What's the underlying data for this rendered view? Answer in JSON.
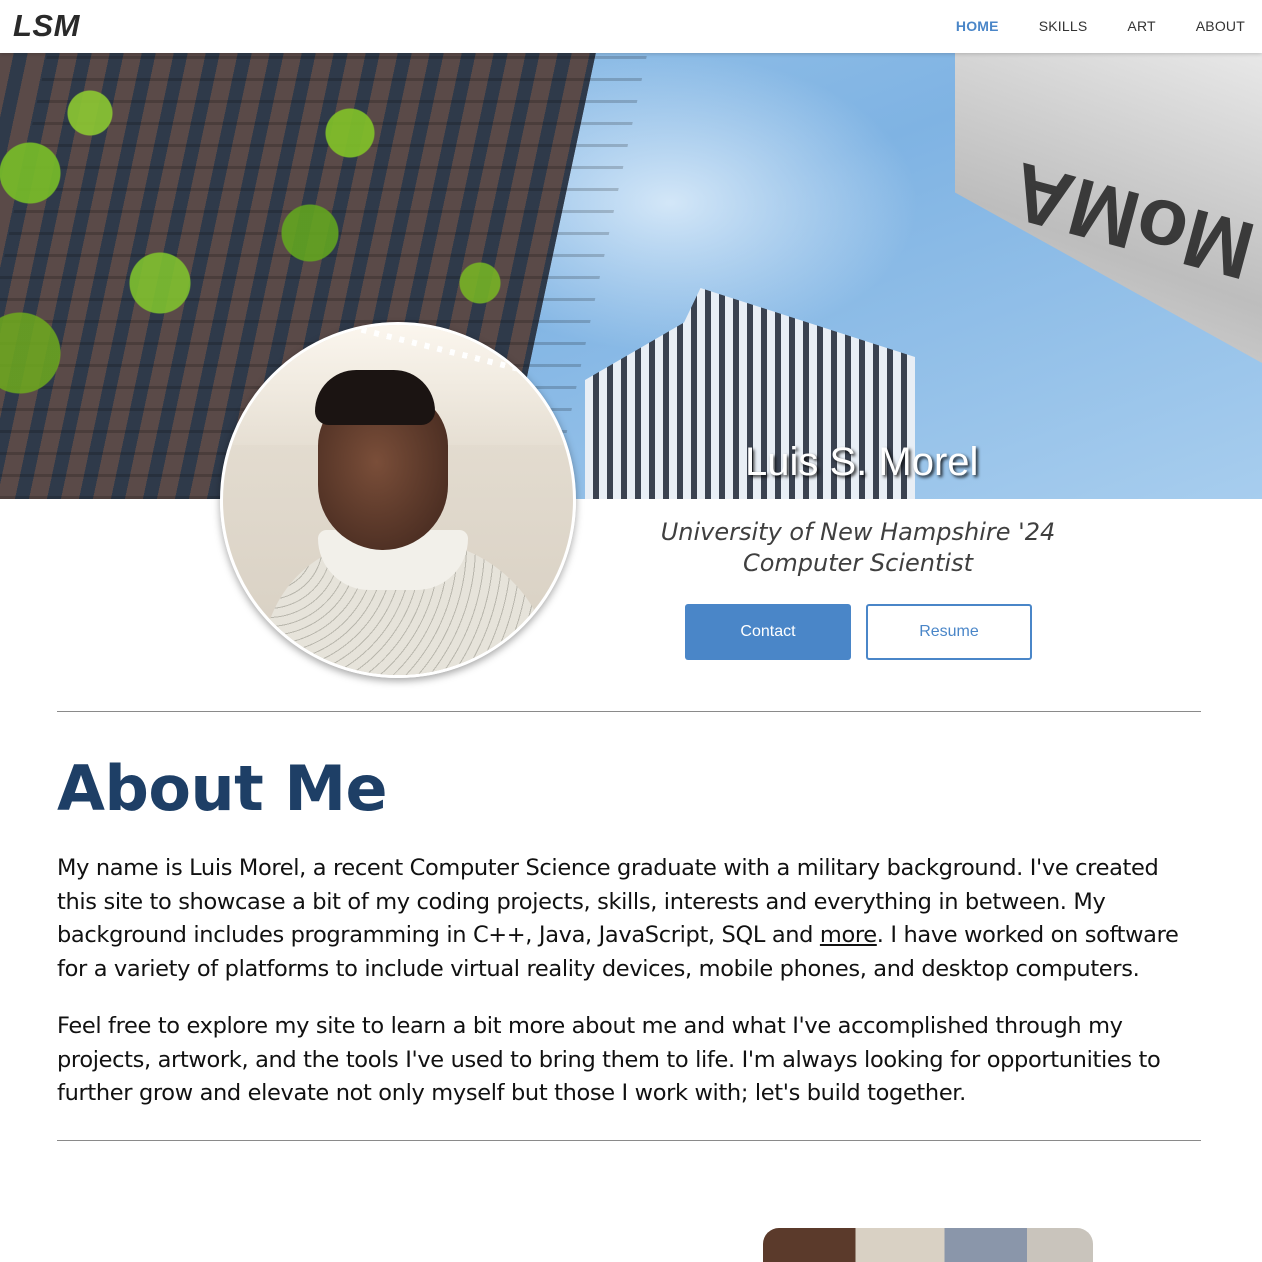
{
  "nav": {
    "brand": "LSM",
    "links": [
      {
        "label": "HOME",
        "active": true
      },
      {
        "label": "SKILLS",
        "active": false
      },
      {
        "label": "ART",
        "active": false
      },
      {
        "label": "ABOUT",
        "active": false
      }
    ]
  },
  "hero": {
    "name": "Luis S. Morel",
    "sign_text": "MoMA"
  },
  "profile": {
    "subtitle_line1": "University of New Hampshire '24",
    "subtitle_line2": "Computer Scientist",
    "contact_label": "Contact",
    "resume_label": "Resume"
  },
  "about": {
    "title": "About Me",
    "p1_before": "My name is Luis Morel, a recent Computer Science graduate with a military background. I've created this site to showcase a bit of my coding projects, skills, interests and everything in between. My background includes programming in C++, Java, JavaScript, SQL and ",
    "p1_link": "more",
    "p1_after": ". I have worked on software for a variety of platforms to include virtual reality devices, mobile phones, and desktop computers.",
    "p2": "Feel free to explore my site to learn a bit more about me and what I've accomplished through my projects, artwork, and the tools I've used to bring them to life. I'm always looking for opportunities to further grow and elevate not only myself but those I work with; let's build together."
  },
  "colors": {
    "accent": "#4a86c8",
    "heading": "#1e3f66"
  }
}
